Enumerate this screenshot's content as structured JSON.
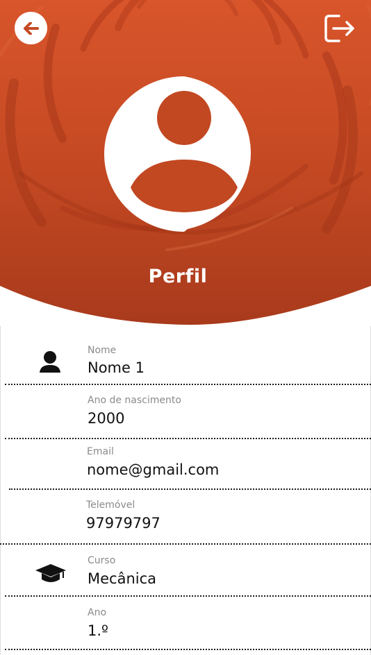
{
  "header": {
    "title": "Perfil",
    "back_icon": "arrow-left-icon",
    "logout_icon": "logout-icon",
    "avatar_icon": "user-avatar-icon",
    "gradient_top": "#d9552b",
    "gradient_bottom": "#a83a1c"
  },
  "profile": {
    "fields": [
      {
        "label": "Nome",
        "value": "Nome 1",
        "icon": "person-icon"
      },
      {
        "label": "Ano de nascimento",
        "value": "2000"
      },
      {
        "label": "Email",
        "value": "nome@gmail.com"
      },
      {
        "label": "Telemóvel",
        "value": "97979797"
      },
      {
        "label": "Curso",
        "value": "Mecânica",
        "icon": "graduation-cap-icon"
      },
      {
        "label": "Ano",
        "value": "1.º"
      }
    ]
  }
}
